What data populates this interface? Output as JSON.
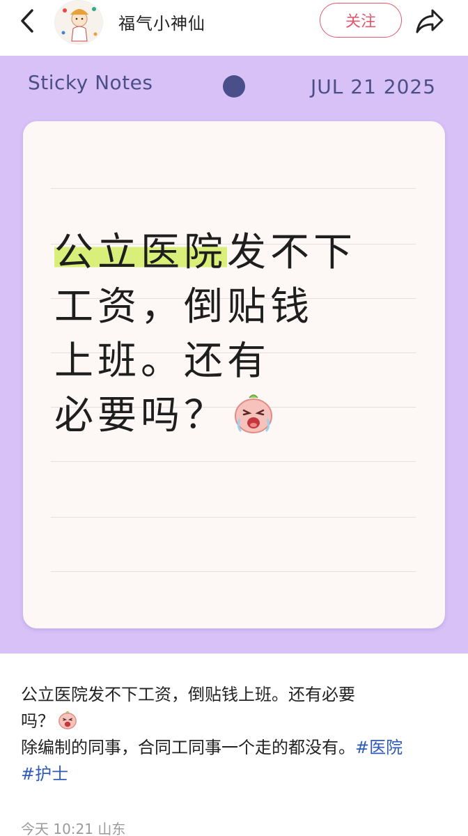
{
  "header": {
    "username": "福气小神仙",
    "follow_label": "关注",
    "back_icon": "chevron-left-icon",
    "share_icon": "share-arrow-icon"
  },
  "sticky": {
    "title": "Sticky Notes",
    "date": "JUL 21 2025",
    "lines": {
      "l1_highlight": "公立医院",
      "l1_rest": "发不下",
      "l2": "工资，倒贴钱",
      "l3": "上班。还有",
      "l4": "必要吗？"
    },
    "emoji_icon": "crying-peach-emoji-icon"
  },
  "caption": {
    "line1": "公立医院发不下工资，倒贴钱上班。还有必要",
    "line2": "吗？",
    "line3": "除编制的同事，合同工同事一个走的都没有。",
    "tag1": "#医院",
    "tag2": "#护士"
  },
  "meta": {
    "time_location": "今天 10:21 山东"
  },
  "colors": {
    "accent": "#e4576e",
    "background_purple": "#d7c1f7",
    "highlight": "#d9ef7a",
    "tag": "#2f5bb8"
  }
}
